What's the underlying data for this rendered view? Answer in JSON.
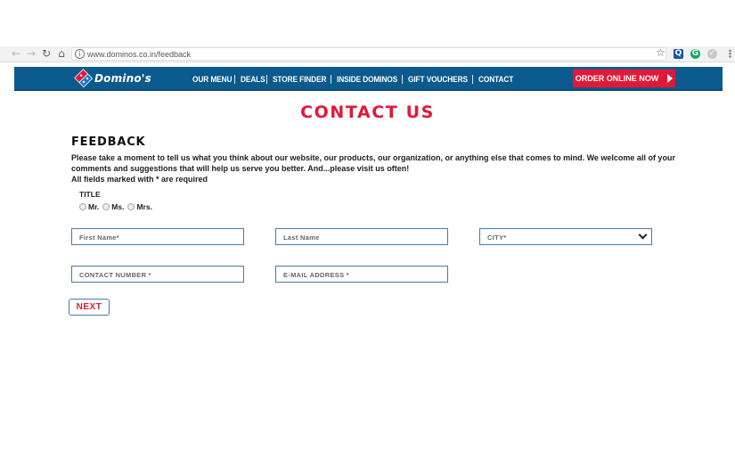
{
  "browser": {
    "url": "www.dominos.co.in/feedback",
    "back_icon": "←",
    "forward_icon": "→",
    "reload_icon": "↻",
    "home_icon": "⌂",
    "info_icon": "i",
    "star_icon": "☆",
    "ext_q": "Q",
    "ext_g": "G",
    "ext_o": "✓",
    "menu_icon": "⋮"
  },
  "header": {
    "logo_text": "Domino's",
    "nav": [
      "OUR MENU",
      "DEALS",
      "STORE FINDER",
      "INSIDE DOMINOS",
      "GIFT VOUCHERS",
      "CONTACT"
    ],
    "order_button": "ORDER ONLINE NOW",
    "colors": {
      "bar": "#0b5a8e",
      "accent": "#e31837"
    }
  },
  "main": {
    "heading": "CONTACT US",
    "feedback_title": "FEEDBACK",
    "intro": "Please take a moment to tell us what you think about our website, our products, our organization, or anything else that comes to mind. We welcome all of your comments and suggestions that will help us serve you better. And...please visit us often!",
    "required_note": "All fields marked with * are required",
    "title_label": "TITLE",
    "title_options": [
      "Mr.",
      "Ms.",
      "Mrs."
    ],
    "fields": {
      "first_name": "First Name*",
      "last_name": "Last Name",
      "city": "CITY*",
      "contact_number": "CONTACT NUMBER *",
      "email": "E-MAIL ADDRESS *"
    },
    "next_button": "NEXT"
  }
}
